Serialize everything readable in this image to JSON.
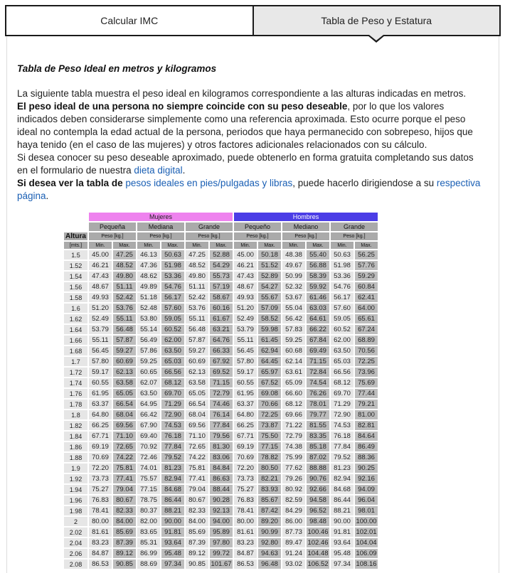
{
  "tabs": [
    {
      "label": "Calcular IMC",
      "active": false
    },
    {
      "label": "Tabla de Peso y Estatura",
      "active": true
    }
  ],
  "heading": "Tabla de Peso Ideal en metros y kilogramos",
  "paragraph": {
    "p1": "La siguiente tabla muestra el peso ideal en kilogramos correspondiente a las alturas indicadas en metros.",
    "p2_bold": "El peso ideal de una persona no siempre coincide con su peso deseable",
    "p2_rest": ", por lo que los valores indicados deben considerarse simplemente como una referencia aproximada. Esto ocurre porque el peso ideal no contempla la edad actual de la persona, periodos que haya permanecido con sobrepeso, hijos que haya tenido (en el caso de las mujeres) y otros factores adicionales relacionados con su cálculo.",
    "p3_pre": "Si desea conocer su peso deseable aproximado, puede obtenerlo en forma gratuita completando sus datos en el formulario de nuestra ",
    "p3_link": "dieta digital",
    "p3_post": ".",
    "p4_bold": "Si desea ver la tabla de ",
    "p4_link": "pesos ideales en pies/pulgadas y libras",
    "p4_mid": ", puede hacerlo dirigiendose a su ",
    "p4_link2": "respectiva página",
    "p4_post": "."
  },
  "table": {
    "groups": [
      "Mujeres",
      "Hombres"
    ],
    "altura_label": "Altura",
    "unit_label": "[mts.]",
    "sizes": [
      "Pequeña",
      "Mediana",
      "Grande",
      "Pequeño",
      "Mediano",
      "Grande"
    ],
    "peso_label": "Peso [kg.]",
    "min_label": "Min.",
    "max_label": "Max.",
    "colors": {
      "mujeres": "#ee82ee",
      "hombres": "#4b3de6"
    },
    "rows": [
      [
        "1.5",
        "45.00",
        "47.25",
        "46.13",
        "50.63",
        "47.25",
        "52.88",
        "45.00",
        "50.18",
        "48.38",
        "55.40",
        "50.63",
        "56.25"
      ],
      [
        "1.52",
        "46.21",
        "48.52",
        "47.36",
        "51.98",
        "48.52",
        "54.29",
        "46.21",
        "51.52",
        "49.67",
        "56.88",
        "51.98",
        "57.76"
      ],
      [
        "1.54",
        "47.43",
        "49.80",
        "48.62",
        "53.36",
        "49.80",
        "55.73",
        "47.43",
        "52.89",
        "50.99",
        "58.39",
        "53.36",
        "59.29"
      ],
      [
        "1.56",
        "48.67",
        "51.11",
        "49.89",
        "54.76",
        "51.11",
        "57.19",
        "48.67",
        "54.27",
        "52.32",
        "59.92",
        "54.76",
        "60.84"
      ],
      [
        "1.58",
        "49.93",
        "52.42",
        "51.18",
        "56.17",
        "52.42",
        "58.67",
        "49.93",
        "55.67",
        "53.67",
        "61.46",
        "56.17",
        "62.41"
      ],
      [
        "1.6",
        "51.20",
        "53.76",
        "52.48",
        "57.60",
        "53.76",
        "60.16",
        "51.20",
        "57.09",
        "55.04",
        "63.03",
        "57.60",
        "64.00"
      ],
      [
        "1.62",
        "52.49",
        "55.11",
        "53.80",
        "59.05",
        "55.11",
        "61.67",
        "52.49",
        "58.52",
        "56.42",
        "64.61",
        "59.05",
        "65.61"
      ],
      [
        "1.64",
        "53.79",
        "56.48",
        "55.14",
        "60.52",
        "56.48",
        "63.21",
        "53.79",
        "59.98",
        "57.83",
        "66.22",
        "60.52",
        "67.24"
      ],
      [
        "1.66",
        "55.11",
        "57.87",
        "56.49",
        "62.00",
        "57.87",
        "64.76",
        "55.11",
        "61.45",
        "59.25",
        "67.84",
        "62.00",
        "68.89"
      ],
      [
        "1.68",
        "56.45",
        "59.27",
        "57.86",
        "63.50",
        "59.27",
        "66.33",
        "56.45",
        "62.94",
        "60.68",
        "69.49",
        "63.50",
        "70.56"
      ],
      [
        "1.7",
        "57.80",
        "60.69",
        "59.25",
        "65.03",
        "60.69",
        "67.92",
        "57.80",
        "64.45",
        "62.14",
        "71.15",
        "65.03",
        "72.25"
      ],
      [
        "1.72",
        "59.17",
        "62.13",
        "60.65",
        "66.56",
        "62.13",
        "69.52",
        "59.17",
        "65.97",
        "63.61",
        "72.84",
        "66.56",
        "73.96"
      ],
      [
        "1.74",
        "60.55",
        "63.58",
        "62.07",
        "68.12",
        "63.58",
        "71.15",
        "60.55",
        "67.52",
        "65.09",
        "74.54",
        "68.12",
        "75.69"
      ],
      [
        "1.76",
        "61.95",
        "65.05",
        "63.50",
        "69.70",
        "65.05",
        "72.79",
        "61.95",
        "69.08",
        "66.60",
        "76.26",
        "69.70",
        "77.44"
      ],
      [
        "1.78",
        "63.37",
        "66.54",
        "64.95",
        "71.29",
        "66.54",
        "74.46",
        "63.37",
        "70.66",
        "68.12",
        "78.01",
        "71.29",
        "79.21"
      ],
      [
        "1.8",
        "64.80",
        "68.04",
        "66.42",
        "72.90",
        "68.04",
        "76.14",
        "64.80",
        "72.25",
        "69.66",
        "79.77",
        "72.90",
        "81.00"
      ],
      [
        "1.82",
        "66.25",
        "69.56",
        "67.90",
        "74.53",
        "69.56",
        "77.84",
        "66.25",
        "73.87",
        "71.22",
        "81.55",
        "74.53",
        "82.81"
      ],
      [
        "1.84",
        "67.71",
        "71.10",
        "69.40",
        "76.18",
        "71.10",
        "79.56",
        "67.71",
        "75.50",
        "72.79",
        "83.35",
        "76.18",
        "84.64"
      ],
      [
        "1.86",
        "69.19",
        "72.65",
        "70.92",
        "77.84",
        "72.65",
        "81.30",
        "69.19",
        "77.15",
        "74.38",
        "85.18",
        "77.84",
        "86.49"
      ],
      [
        "1.88",
        "70.69",
        "74.22",
        "72.46",
        "79.52",
        "74.22",
        "83.06",
        "70.69",
        "78.82",
        "75.99",
        "87.02",
        "79.52",
        "88.36"
      ],
      [
        "1.9",
        "72.20",
        "75.81",
        "74.01",
        "81.23",
        "75.81",
        "84.84",
        "72.20",
        "80.50",
        "77.62",
        "88.88",
        "81.23",
        "90.25"
      ],
      [
        "1.92",
        "73.73",
        "77.41",
        "75.57",
        "82.94",
        "77.41",
        "86.63",
        "73.73",
        "82.21",
        "79.26",
        "90.76",
        "82.94",
        "92.16"
      ],
      [
        "1.94",
        "75.27",
        "79.04",
        "77.15",
        "84.68",
        "79.04",
        "88.44",
        "75.27",
        "83.93",
        "80.92",
        "92.66",
        "84.68",
        "94.09"
      ],
      [
        "1.96",
        "76.83",
        "80.67",
        "78.75",
        "86.44",
        "80.67",
        "90.28",
        "76.83",
        "85.67",
        "82.59",
        "94.58",
        "86.44",
        "96.04"
      ],
      [
        "1.98",
        "78.41",
        "82.33",
        "80.37",
        "88.21",
        "82.33",
        "92.13",
        "78.41",
        "87.42",
        "84.29",
        "96.52",
        "88.21",
        "98.01"
      ],
      [
        "2",
        "80.00",
        "84.00",
        "82.00",
        "90.00",
        "84.00",
        "94.00",
        "80.00",
        "89.20",
        "86.00",
        "98.48",
        "90.00",
        "100.00"
      ],
      [
        "2.02",
        "81.61",
        "85.69",
        "83.65",
        "91.81",
        "85.69",
        "95.89",
        "81.61",
        "90.99",
        "87.73",
        "100.46",
        "91.81",
        "102.01"
      ],
      [
        "2.04",
        "83.23",
        "87.39",
        "85.31",
        "93.64",
        "87.39",
        "97.80",
        "83.23",
        "92.80",
        "89.47",
        "102.46",
        "93.64",
        "104.04"
      ],
      [
        "2.06",
        "84.87",
        "89.12",
        "86.99",
        "95.48",
        "89.12",
        "99.72",
        "84.87",
        "94.63",
        "91.24",
        "104.48",
        "95.48",
        "106.09"
      ],
      [
        "2.08",
        "86.53",
        "90.85",
        "88.69",
        "97.34",
        "90.85",
        "101.67",
        "86.53",
        "96.48",
        "93.02",
        "106.52",
        "97.34",
        "108.16"
      ]
    ]
  }
}
